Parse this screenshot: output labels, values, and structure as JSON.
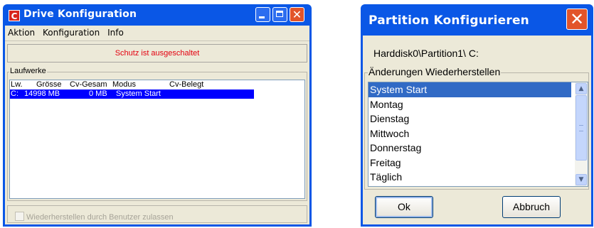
{
  "drive_window": {
    "title": "Drive Konfiguration",
    "icon_letter": "C",
    "menu": [
      "Aktion",
      "Konfiguration",
      "Info"
    ],
    "status_text": "Schutz ist ausgeschaltet",
    "group_label": "Laufwerke",
    "columns": [
      "Lw.",
      "Grösse",
      "Cv-Gesam",
      "Modus",
      "Cv-Belegt"
    ],
    "rows": [
      {
        "lw": "C:",
        "groesse": "14998 MB",
        "cv_gesam": "0 MB",
        "modus": "System Start",
        "cv_belegt": ""
      }
    ],
    "checkbox_label": "Wiederherstellen durch Benutzer zulassen",
    "checkbox_checked": false,
    "status_color": "#e3000f",
    "selection_color": "#0000ff"
  },
  "partition_dialog": {
    "title": "Partition Konfigurieren",
    "path": "Harddisk0\\Partition1\\ C:",
    "group_label": "Änderungen Wiederherstellen",
    "options": [
      "System Start",
      "Montag",
      "Dienstag",
      "Mittwoch",
      "Donnerstag",
      "Freitag",
      "Täglich"
    ],
    "selected_option": "System Start",
    "ok_label": "Ok",
    "cancel_label": "Abbruch"
  },
  "icons": {
    "minimize": "minimize-icon",
    "maximize": "maximize-icon",
    "close": "close-icon",
    "scroll_up": "chevron-up-icon",
    "scroll_down": "chevron-down-icon"
  }
}
